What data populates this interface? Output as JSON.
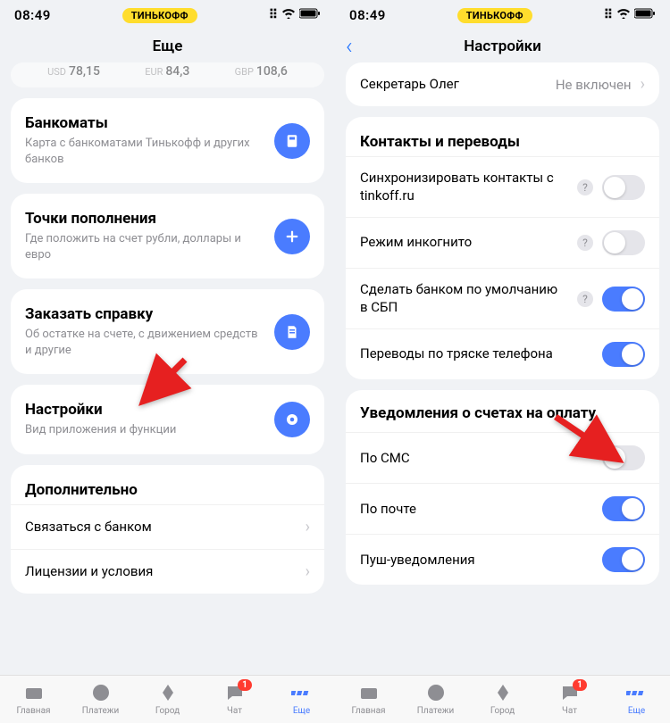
{
  "status": {
    "time": "08:49",
    "brand": "ТИНЬКОФФ"
  },
  "left": {
    "title": "Еще",
    "currencies": [
      {
        "label": "USD",
        "value": "78,15"
      },
      {
        "label": "EUR",
        "value": "84,3"
      },
      {
        "label": "GBP",
        "value": "108,6"
      }
    ],
    "cards": [
      {
        "title": "Банкоматы",
        "subtitle": "Карта с банкоматами Тинькофф и других банков"
      },
      {
        "title": "Точки пополнения",
        "subtitle": "Где положить на счет рубли, доллары и евро"
      },
      {
        "title": "Заказать справку",
        "subtitle": "Об остатке на счете, с движением средств и другие"
      },
      {
        "title": "Настройки",
        "subtitle": "Вид приложения и функции"
      }
    ],
    "extra": {
      "title": "Дополнительно",
      "items": [
        "Связаться с банком",
        "Лицензии и условия"
      ]
    }
  },
  "right": {
    "title": "Настройки",
    "secretary": {
      "label": "Секретарь Олег",
      "value": "Не включен"
    },
    "contacts": {
      "title": "Контакты и переводы",
      "items": [
        {
          "label": "Синхронизировать контакты с tinkoff.ru",
          "on": false,
          "help": true
        },
        {
          "label": "Режим инкогнито",
          "on": false,
          "help": true
        },
        {
          "label": "Сделать банком по умолчанию в СБП",
          "on": true,
          "help": true
        },
        {
          "label": "Переводы по тряске телефона",
          "on": true,
          "help": false
        }
      ]
    },
    "notifications": {
      "title": "Уведомления о счетах на оплату",
      "items": [
        {
          "label": "По СМС",
          "on": false
        },
        {
          "label": "По почте",
          "on": true
        },
        {
          "label": "Пуш-уведомления",
          "on": true
        }
      ]
    }
  },
  "tabs": [
    {
      "label": "Главная",
      "badge": null
    },
    {
      "label": "Платежи",
      "badge": null
    },
    {
      "label": "Город",
      "badge": null
    },
    {
      "label": "Чат",
      "badge": "1"
    },
    {
      "label": "Еще",
      "badge": null
    }
  ]
}
